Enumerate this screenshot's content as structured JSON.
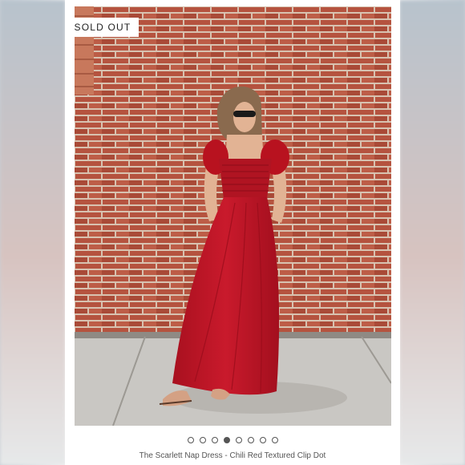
{
  "badge": {
    "label": "SOLD OUT"
  },
  "carousel": {
    "count": 8,
    "active_index": 3
  },
  "caption": {
    "text": "The Scarlett Nap Dress - Chili Red Textured Clip Dot"
  },
  "colors": {
    "dress": "#c0182a",
    "brick": "#b5533f",
    "mortar": "#d8c2b0",
    "sidewalk": "#c9c7c3",
    "badge_bg": "#ffffff"
  },
  "icons": {
    "photo": "product-photo"
  }
}
